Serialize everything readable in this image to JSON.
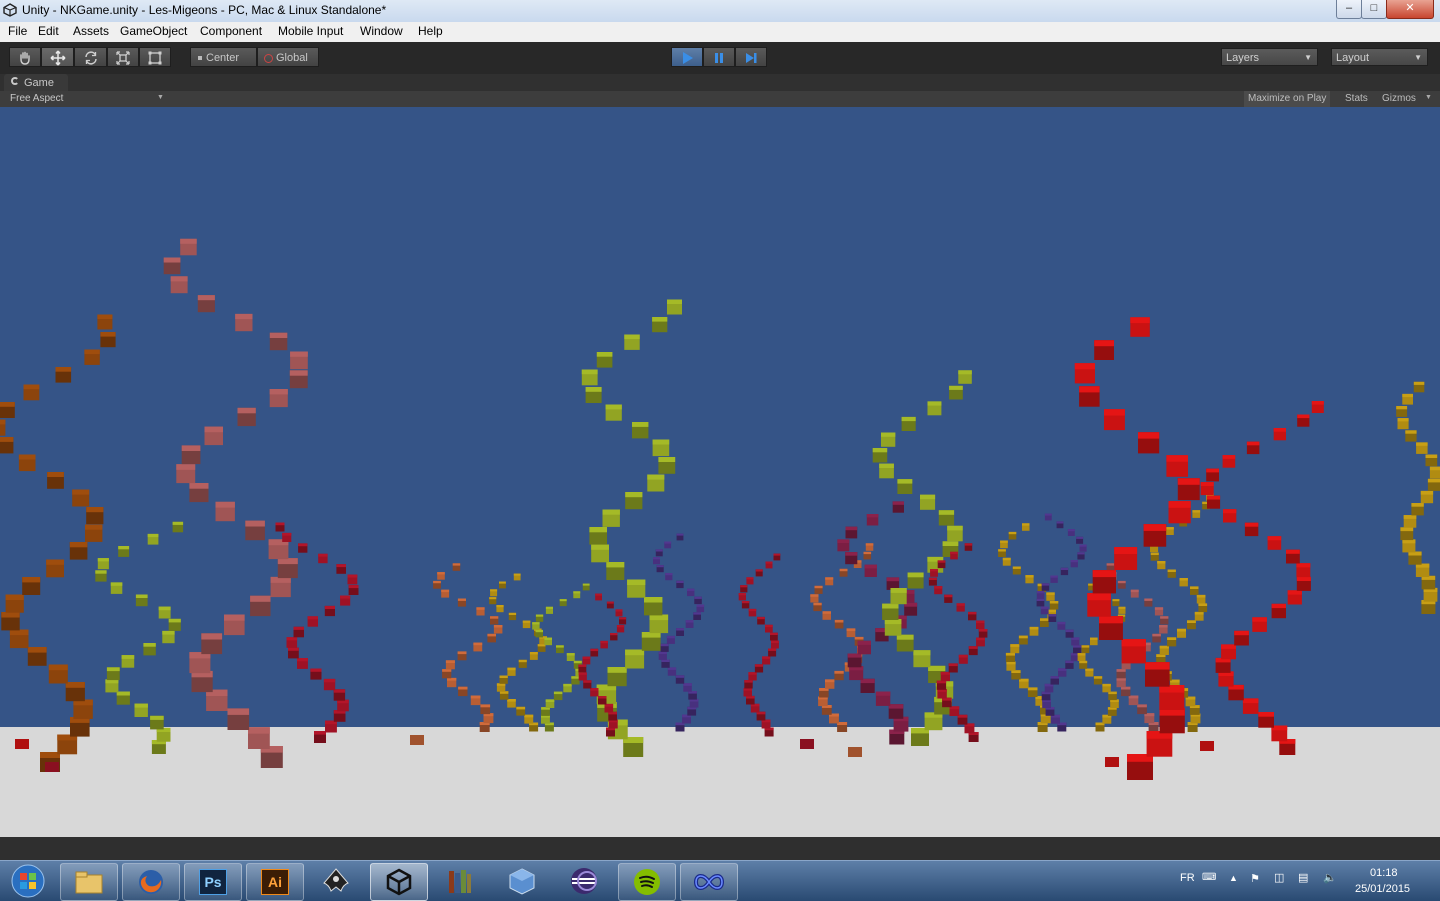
{
  "window": {
    "title": "Unity - NKGame.unity - Les-Migeons - PC, Mac & Linux Standalone*",
    "minimize_glyph": "–",
    "maximize_glyph": "□",
    "close_glyph": "✕"
  },
  "menu": [
    "File",
    "Edit",
    "Assets",
    "GameObject",
    "Component",
    "Mobile Input",
    "Window",
    "Help"
  ],
  "toolbar": {
    "pivot_label": "Center",
    "space_label": "Global",
    "layers_label": "Layers",
    "layout_label": "Layout",
    "icons": [
      "hand-icon",
      "move-icon",
      "rotate-icon",
      "scale-icon",
      "rect-icon",
      "play-icon",
      "pause-icon",
      "step-icon"
    ]
  },
  "game_panel": {
    "tab_label": "Game",
    "aspect_label": "Free Aspect",
    "maximize_label": "Maximize on Play",
    "stats_label": "Stats",
    "gizmos_label": "Gizmos"
  },
  "scene": {
    "sky_color": "#355487",
    "ground_color": "#d8d8d8",
    "vine_colors": [
      "#7a3b0a",
      "#8b4a4a",
      "#7f8f1e",
      "#8a1020",
      "#b01010",
      "#3f2a6e",
      "#a0522d",
      "#9a7a10",
      "#6b1a3a"
    ]
  },
  "taskbar": {
    "apps": [
      "windows-start-icon",
      "explorer-icon",
      "firefox-icon",
      "photoshop-icon",
      "illustrator-icon",
      "inkscape-icon",
      "unity-icon",
      "books-icon",
      "virtualbox-icon",
      "eclipse-icon",
      "spotify-icon",
      "infinity-icon"
    ],
    "ps_label": "Ps",
    "ai_label": "Ai",
    "lang": "FR",
    "time": "01:18",
    "date": "25/01/2015"
  }
}
